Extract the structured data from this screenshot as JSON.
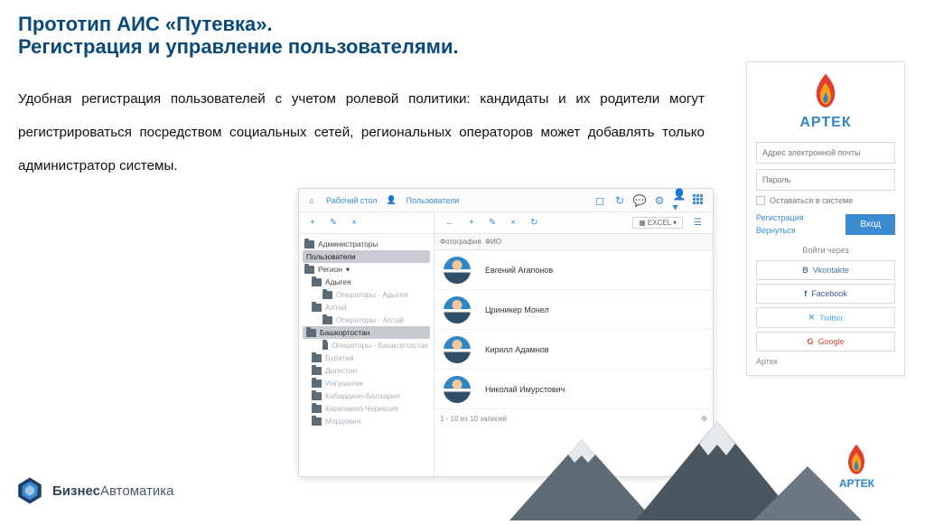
{
  "title_line1": "Прототип АИС «Путевка».",
  "title_line2": "Регистрация и управление пользователями.",
  "paragraph": "Удобная регистрация пользователей с учетом ролевой политики: кандидаты и их родители могут регистрироваться посредством социальных сетей, региональных операторов может добавлять только администратор системы.",
  "app": {
    "crumb_home": "Рабочий стол",
    "crumb_users": "Пользователи",
    "tree": {
      "root": "Администраторы",
      "sel": "Пользователи",
      "region": "Регион",
      "items": [
        "Адыгея",
        "Операторы - Адыгея",
        "Алтай",
        "Операторы - Алтай",
        "Башкортостан",
        "Операторы - Башкортостан",
        "Бурятия",
        "Дагестан",
        "Ингушетия",
        "Кабардино-Балкария",
        "Карачаево-Черкесия",
        "Мордовия"
      ]
    },
    "col_photo": "Фотография",
    "col_fio": "ФИО",
    "excel": "EXCEL",
    "rows": [
      "Евгений Агапонов",
      "Цриникер Монел",
      "Кирилл Адамнов",
      "Николай Имурстович"
    ],
    "footer_count": "1 - 10 из 10 записей"
  },
  "login": {
    "brand": "АРТЕК",
    "email_ph": "Адрес электронной почты",
    "pass_ph": "Пароль",
    "remember": "Оставаться в системе",
    "register": "Регистрация",
    "back": "Вернуться",
    "submit": "Вход",
    "social_hdr": "Войти через",
    "vk": "Vkontakte",
    "fb": "Facebook",
    "tw": "Twitter",
    "gg": "Google",
    "foot": "Артек"
  },
  "company": {
    "bold": "Бизнес",
    "rest": "Автоматика"
  }
}
